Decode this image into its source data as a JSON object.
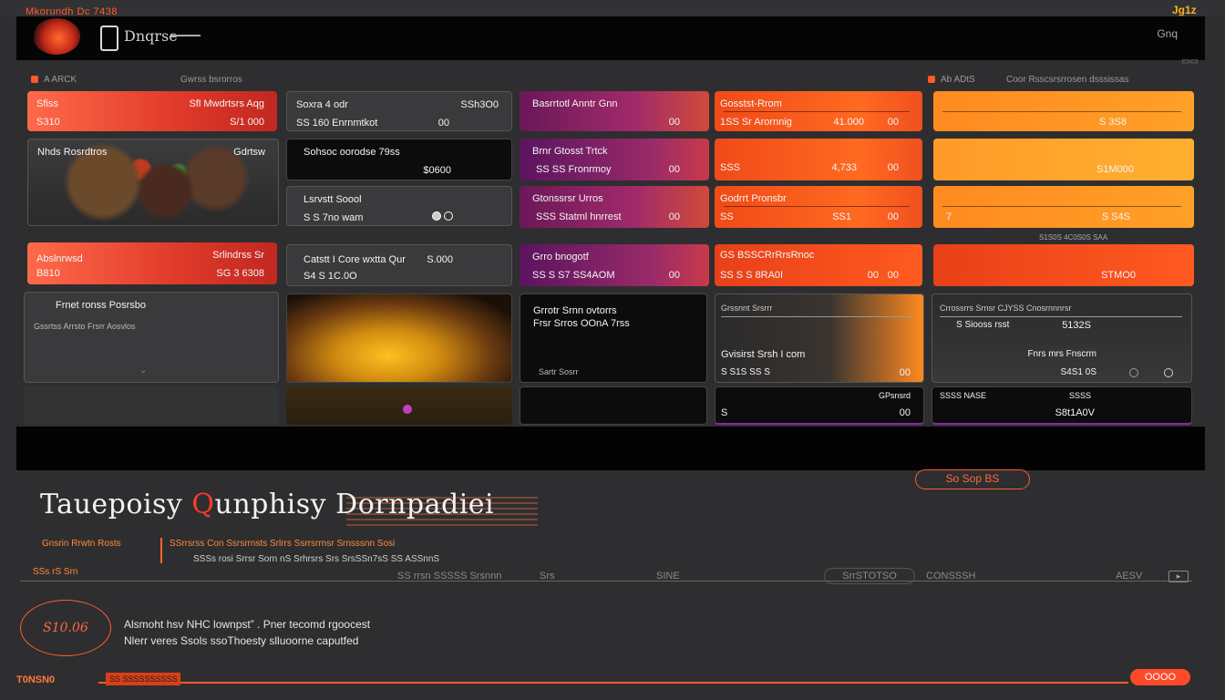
{
  "topbar": {
    "title": "Mkorundh Dc 7438",
    "badge": "Jg1z"
  },
  "header": {
    "brand": "Dnqrse",
    "right_label": "Gnq"
  },
  "columns": [
    {
      "label": "A ARCK",
      "sub": "Gwrss bsrorros"
    },
    {
      "label": "",
      "sub": ""
    },
    {
      "label": "",
      "sub": ""
    },
    {
      "label": "Ab ADtS",
      "sub": "Coor Rsscsrsrrosen dsssissas"
    }
  ],
  "grid": {
    "c1": [
      {
        "l1": "Sfiss",
        "l2": "S310",
        "r1": "Sfl Mwdrtsrs Aqg",
        "r2": "S/1 000"
      },
      {
        "l1": "Nhds Rosrdtros",
        "r1": "Gdrtsw"
      },
      {
        "l1": "Abslnrwsd",
        "l2": "B810",
        "r1": "Srlindrss Sr",
        "r2": "SG 3 6308"
      },
      {
        "l1": "Frnet ronss Posrsbo",
        "l2": "Gssrtss Arrsto Frsrr Aosvlos"
      }
    ],
    "c2": [
      {
        "l1": "Soxra 4 odr",
        "l2": "SS 160 Enrnmtkot",
        "r1": "SSh3O0",
        "r2": "00"
      },
      {
        "l1": "Sohsoc oorodse 79ss",
        "r2": "$0600"
      },
      {
        "l1": "Lsrvstt Soool",
        "l2": "S S 7no wam"
      },
      {
        "l1": "Catstt I Core wxtta Qur",
        "l2": "S4 S 1C.0O",
        "r1": "S.000"
      }
    ],
    "c3": [
      {
        "l1": "Basrrtotl Anntr Gnn",
        "r2": "00"
      },
      {
        "l1": "Brnr Gtosst Trtck",
        "l2": "SS SS Fronrmoy",
        "r2": "00"
      },
      {
        "l1": "Gtonssrsr Urros",
        "l2": "SSS Statml hnrrest",
        "r2": "00"
      },
      {
        "l1": "Grro bnogotf",
        "l2": "SS S S7 SS4AOM",
        "r2": "00"
      },
      {
        "l1": "Grrotr Srnn ovtorrs",
        "l2": "Frsr Srros OOnA 7rss",
        "r1": "Sartr Sosrr"
      }
    ],
    "c4": [
      {
        "l1": "Gosstst-Rrom",
        "l2": "1SS Sr Arornnig",
        "mid2": "41.000",
        "r2": "00"
      },
      {
        "l1": "",
        "l2": "SSS",
        "mid2": "4,733",
        "r2": "00"
      },
      {
        "l1": "Godrrt Pronsbr",
        "l2": "SS",
        "mid2": "SS1",
        "r2": "00"
      },
      {
        "l1": "GS BSSCRrRrsRnoc",
        "l2": "SS S S 8RA0I",
        "mid2": "00",
        "r2": "00"
      },
      {
        "l1": "Grssnnt Srsrrr",
        "l2": "Gvisirst Srsh I com",
        "mid2": "S S1S SS S",
        "r2": "00"
      },
      {
        "l1": "S",
        "r1": "GPsnsrd",
        "r2": "00"
      }
    ],
    "c5": [
      {
        "r2": "S 3S8"
      },
      {
        "r2": "S1M000"
      },
      {
        "l2": "7",
        "r2": "S S4S"
      },
      {
        "r1": "S1S0S 4C0S0S SAA",
        "r2": "STMO0"
      },
      {
        "l1": "Crrossrrs Srnsr CJYSS Cnosrnnnrsr",
        "l2": "S Siooss rsst",
        "r1": "5132S",
        "mid2": "Fnrs mrs Fnscrm",
        "r2": "S4S1 0S"
      },
      {
        "l1": "SSSS NASE",
        "r1": "SSSS",
        "r2": "S8t1A0V"
      }
    ]
  },
  "hero": {
    "title_a": "Tauepoisy ",
    "title_accent": "Q",
    "title_b": "unphisy Dornpadiei",
    "sub1": "Gnsrin Rrwtn Rosts",
    "sub2": "SSrrsrss Con Ssrsrrnsts Srlrrs Ssrrsrrnsr Srnsssnn Sosi",
    "sub3": "SSSs rosi Srrsr Sorn nS Srhrsrs Srs SrsSSn7sS SS ASSnnS",
    "sub4": "SSs rS Srn"
  },
  "timeline": {
    "labels": [
      "SS rrsn SSSSS Srsnnn",
      "Srs",
      "SINE",
      "CONSSSH",
      "AESV"
    ],
    "box": "SrrSTOTSO",
    "oval_button": "So Sop BS"
  },
  "about": {
    "logo_text": "S10.06",
    "line1": "Alsmoht hsv NHC lownpst” . Pner tecomd rgoocest",
    "line2": "Nlerr veres Ssols ssoThoesty slluoorne caputfed"
  },
  "footer": {
    "left": "T0NSN0",
    "tag": "SS SSSSSSSSSS",
    "pill": "OOOO"
  },
  "colors": {
    "accent": "#ff5a2a",
    "background": "#2e2e30",
    "orange": "#ff8a20",
    "purple": "#8a2266"
  }
}
